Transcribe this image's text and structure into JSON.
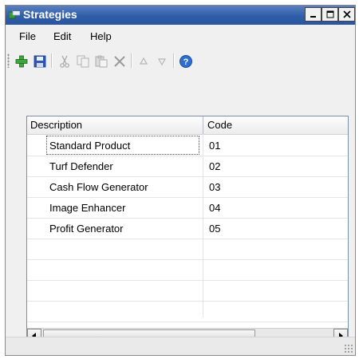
{
  "window": {
    "title": "Strategies",
    "title_bar_color": "#2f5ea8"
  },
  "menu": {
    "items": [
      "File",
      "Edit",
      "Help"
    ]
  },
  "toolbar": {
    "icons": [
      "add-icon",
      "save-icon",
      "cut-icon",
      "copy-icon",
      "paste-icon",
      "delete-icon",
      "move-up-icon",
      "move-down-icon",
      "help-icon"
    ]
  },
  "list": {
    "columns": [
      "Description",
      "Code"
    ],
    "rows": [
      {
        "description": "Standard Product",
        "code": "01"
      },
      {
        "description": "Turf Defender",
        "code": "02"
      },
      {
        "description": "Cash Flow Generator",
        "code": "03"
      },
      {
        "description": "Image Enhancer",
        "code": "04"
      },
      {
        "description": "Profit Generator",
        "code": "05"
      }
    ]
  }
}
